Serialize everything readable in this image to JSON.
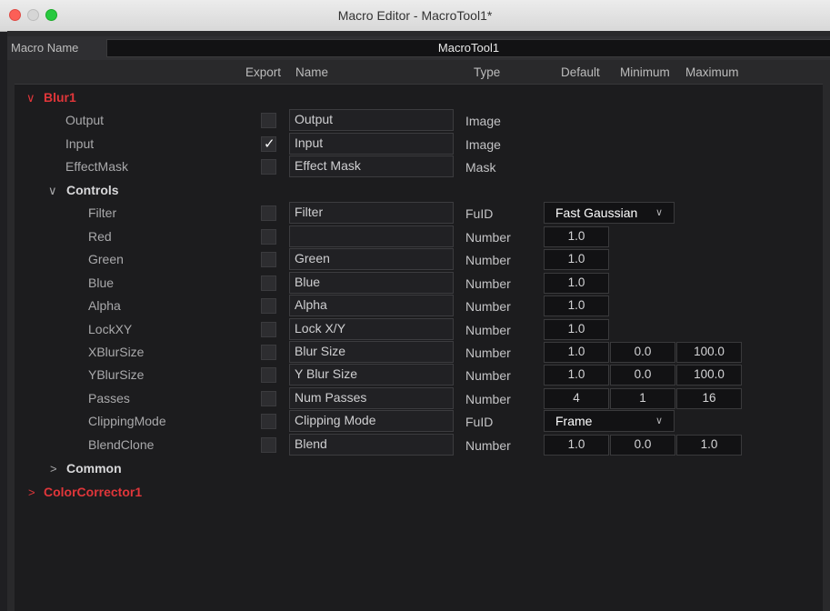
{
  "window": {
    "title": "Macro Editor - MacroTool1*"
  },
  "macro_name": {
    "label": "Macro Name",
    "value": "MacroTool1"
  },
  "columns": {
    "export": "Export",
    "name": "Name",
    "type": "Type",
    "default": "Default",
    "minimum": "Minimum",
    "maximum": "Maximum"
  },
  "glyphs": {
    "expanded": "∨",
    "collapsed": ">",
    "check": "✓",
    "dropdown": "∨"
  },
  "tree": {
    "blur1": {
      "label": "Blur1",
      "items": [
        {
          "label": "Output",
          "exported": false,
          "name": "Output",
          "type": "Image"
        },
        {
          "label": "Input",
          "exported": true,
          "name": "Input",
          "type": "Image"
        },
        {
          "label": "EffectMask",
          "exported": false,
          "name": "Effect Mask",
          "type": "Mask"
        }
      ],
      "controls": {
        "label": "Controls",
        "items": [
          {
            "label": "Filter",
            "exported": false,
            "name": "Filter",
            "type": "FuID",
            "default": "Fast Gaussian"
          },
          {
            "label": "Red",
            "exported": false,
            "name": "",
            "type": "Number",
            "default": "1.0"
          },
          {
            "label": "Green",
            "exported": false,
            "name": "Green",
            "type": "Number",
            "default": "1.0"
          },
          {
            "label": "Blue",
            "exported": false,
            "name": "Blue",
            "type": "Number",
            "default": "1.0"
          },
          {
            "label": "Alpha",
            "exported": false,
            "name": "Alpha",
            "type": "Number",
            "default": "1.0"
          },
          {
            "label": "LockXY",
            "exported": false,
            "name": "Lock X/Y",
            "type": "Number",
            "default": "1.0"
          },
          {
            "label": "XBlurSize",
            "exported": false,
            "name": "Blur Size",
            "type": "Number",
            "default": "1.0",
            "minimum": "0.0",
            "maximum": "100.0"
          },
          {
            "label": "YBlurSize",
            "exported": false,
            "name": "Y Blur Size",
            "type": "Number",
            "default": "1.0",
            "minimum": "0.0",
            "maximum": "100.0"
          },
          {
            "label": "Passes",
            "exported": false,
            "name": "Num Passes",
            "type": "Number",
            "default": "4",
            "minimum": "1",
            "maximum": "16"
          },
          {
            "label": "ClippingMode",
            "exported": false,
            "name": "Clipping Mode",
            "type": "FuID",
            "default": "Frame"
          },
          {
            "label": "BlendClone",
            "exported": false,
            "name": "Blend",
            "type": "Number",
            "default": "1.0",
            "minimum": "0.0",
            "maximum": "1.0"
          }
        ]
      },
      "common": {
        "label": "Common"
      }
    },
    "colorcorrector1": {
      "label": "ColorCorrector1"
    }
  },
  "colors": {
    "node_label": "#e0363a",
    "background": "#1c1c1e",
    "title_bar": "#e3e3e3",
    "close_button": "#fc5f57",
    "zoom_button": "#27c93f"
  }
}
